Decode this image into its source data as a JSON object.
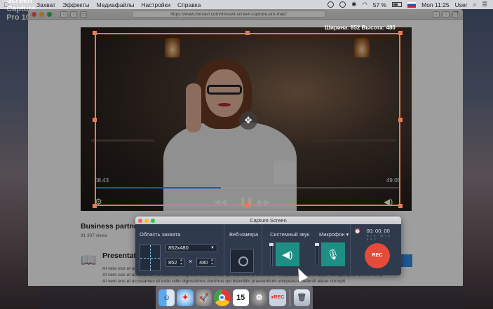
{
  "menubar": {
    "app_name": "Movavi Screen Capture Pro 10",
    "items": [
      "Захват",
      "Эффекты",
      "Медиафайлы",
      "Настройки",
      "Справка"
    ],
    "battery": "57 %",
    "clock": "Mon 11:25",
    "user": "User"
  },
  "browser": {
    "url": "https://www.movavi.com/movavi-screen-capture-pro-mac/",
    "video": {
      "time_current": "08.43",
      "time_total": "49.06",
      "progress_fraction": 0.41
    },
    "page": {
      "heading": "Business partner",
      "views": "91 307 views",
      "lorem_short": "At vero eos et accusamus et iusto odio dignissimos ducimus qui blanditiis praesentium voluptatum deleniti atque corrupti quos dolores et q",
      "section_title": "Presentat",
      "lorem_long_1": "At vero eos et accusamus",
      "lorem_long_2": "At vero eos et accusamus et iusto odio dignissimos ducimus qui blanditiis praesentium voluptatum deleniti atque corrupti"
    }
  },
  "selection": {
    "size_label": "Ширина: 852  Высота: 480"
  },
  "capture_panel": {
    "title": "Capture Screen",
    "area_label": "Область захвата",
    "preset_value": "852x480",
    "width_value": "852",
    "height_value": "480",
    "times_sign": "×",
    "webcam_label": "Веб-камера",
    "system_sound_label": "Системный звук",
    "microphone_label": "Микрофон ▾",
    "timer": "00: 00: 00",
    "timer_units": "hrs min sec",
    "rec_label": "REC",
    "colors": {
      "accent_orange": "#f07a50",
      "teal": "#1f8f86",
      "rec_red": "#e54a3a"
    }
  },
  "dock": {
    "apps": [
      "finder-icon",
      "safari-icon",
      "launchpad-icon",
      "chrome-icon",
      "calendar-icon",
      "system-preferences-icon",
      "movavi-icon",
      "trash-icon"
    ],
    "calendar_day": "15"
  }
}
